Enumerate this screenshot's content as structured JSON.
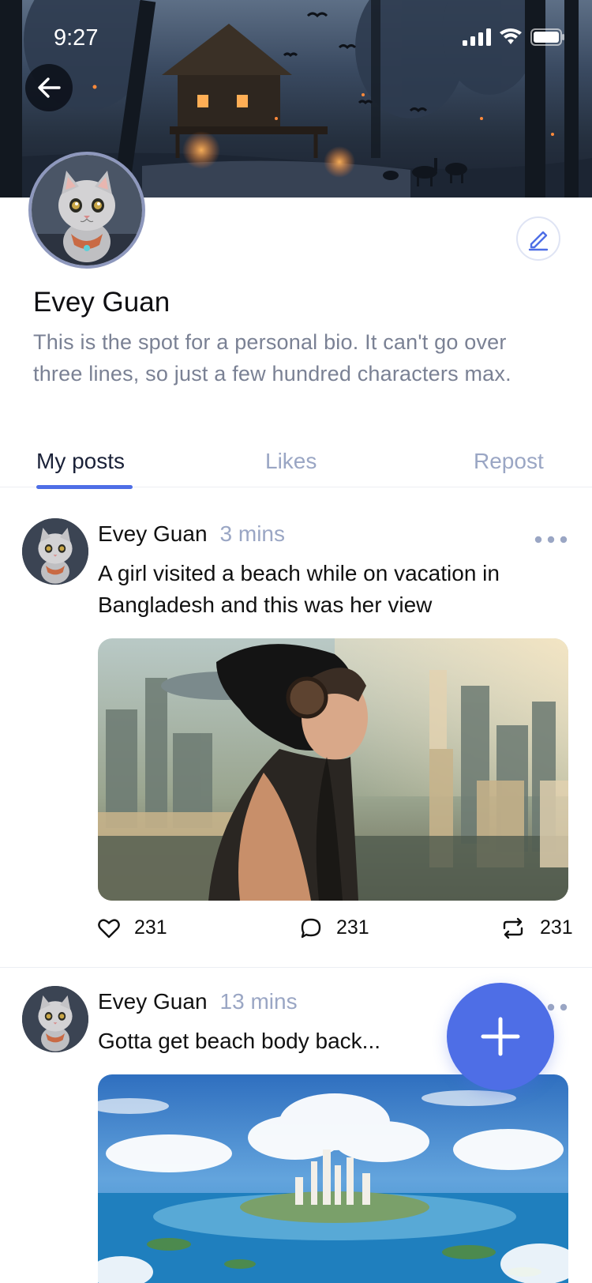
{
  "status_bar": {
    "time": "9:27",
    "icons": [
      "signal-icon",
      "wifi-icon",
      "battery-icon"
    ]
  },
  "cover": {
    "description_icon": "cover-forest-cabin-image"
  },
  "header": {
    "back_icon": "arrow-left-icon",
    "edit_icon": "pencil-icon"
  },
  "profile": {
    "name": "Evey Guan",
    "bio": "This is the spot for a personal bio. It can't go over three lines, so just a few hundred characters max."
  },
  "tabs": [
    {
      "label": "My posts",
      "active": true
    },
    {
      "label": "Likes",
      "active": false
    },
    {
      "label": "Repost",
      "active": false
    }
  ],
  "posts": [
    {
      "author": "Evey Guan",
      "time": "3 mins",
      "text": "A girl visited a beach while on vacation in Bangladesh and this was her view",
      "image_icon": "cyberpunk-girl-city-image",
      "likes": "231",
      "comments": "231",
      "reposts": "231"
    },
    {
      "author": "Evey Guan",
      "time": "13 mins",
      "text": "Gotta get beach body back...",
      "image_icon": "floating-island-sea-image"
    }
  ],
  "fab": {
    "icon": "plus-icon"
  },
  "colors": {
    "accent": "#4e6ee6",
    "muted": "#9aa6c4",
    "bio": "#7a8194"
  }
}
